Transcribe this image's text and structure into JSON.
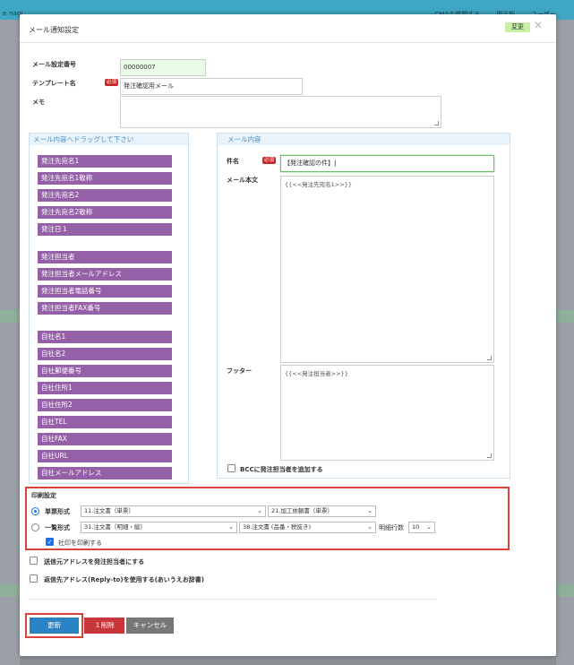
{
  "backdrop": {
    "left_text": "≡ nagi",
    "right_items": [
      "CMAの質問する",
      "掲示板",
      "ユーザー"
    ]
  },
  "modal": {
    "title": "メール通知設定",
    "change_label": "変更",
    "close_icon": "close-icon"
  },
  "form": {
    "mail_setting_no_label": "メール設定番号",
    "mail_setting_no_value": "00000007",
    "template_label": "テンプレート名",
    "required_label": "必須",
    "template_value": "発注確認用メール",
    "memo_label": "メモ",
    "memo_value": ""
  },
  "drag_panel": {
    "title": "メール内容へドラッグして下さい",
    "groups": [
      [
        "発注先宛名1",
        "発注先宛名1敬称",
        "発注先宛名2",
        "発注先宛名2敬称",
        "発注日１"
      ],
      [
        "発注担当者",
        "発注担当者メールアドレス",
        "発注担当者電話番号",
        "発注担当者FAX番号"
      ],
      [
        "自社名1",
        "自社名2",
        "自社郵便番号",
        "自社住所1",
        "自社住所2",
        "自社TEL",
        "自社FAX",
        "自社URL",
        "自社メールアドレス"
      ]
    ]
  },
  "mail_panel": {
    "title": "メール内容",
    "subject_label": "件名",
    "subject_value": "【発注確認の件】",
    "body_label": "メール本文",
    "body_value": "{{<<発注先宛名1>>}}",
    "footer_label": "フッター",
    "footer_value": "{{<<発注担当者>>}}",
    "bcc_label": "BCCに発注担当者を追加する"
  },
  "print": {
    "title": "印刷設定",
    "single_label": "単票形式",
    "single_select_1": "11.注文書（単票）",
    "single_select_2": "21.加工依頼書（単票）",
    "list_label": "一覧形式",
    "list_select_1": "31.注文書（明細・縦）",
    "list_select_2": "38.注文書 (品番・税抜き)",
    "detail_rows_label": "明細行数",
    "detail_rows_value": "10",
    "stamp_label": "社印を印刷する"
  },
  "options": {
    "sender_label": "送信元アドレスを発注担当者にする",
    "reply_to_label": "返信先アドレス(Reply-to)を使用する(あいうえお辞書)"
  },
  "actions": {
    "update": "更新",
    "delete": "１削除",
    "cancel": "キャンセル"
  },
  "colors": {
    "tag_purple": "#9560a8",
    "primary": "#2a83c4",
    "danger": "#c8353a",
    "highlight_red": "#d84438"
  }
}
